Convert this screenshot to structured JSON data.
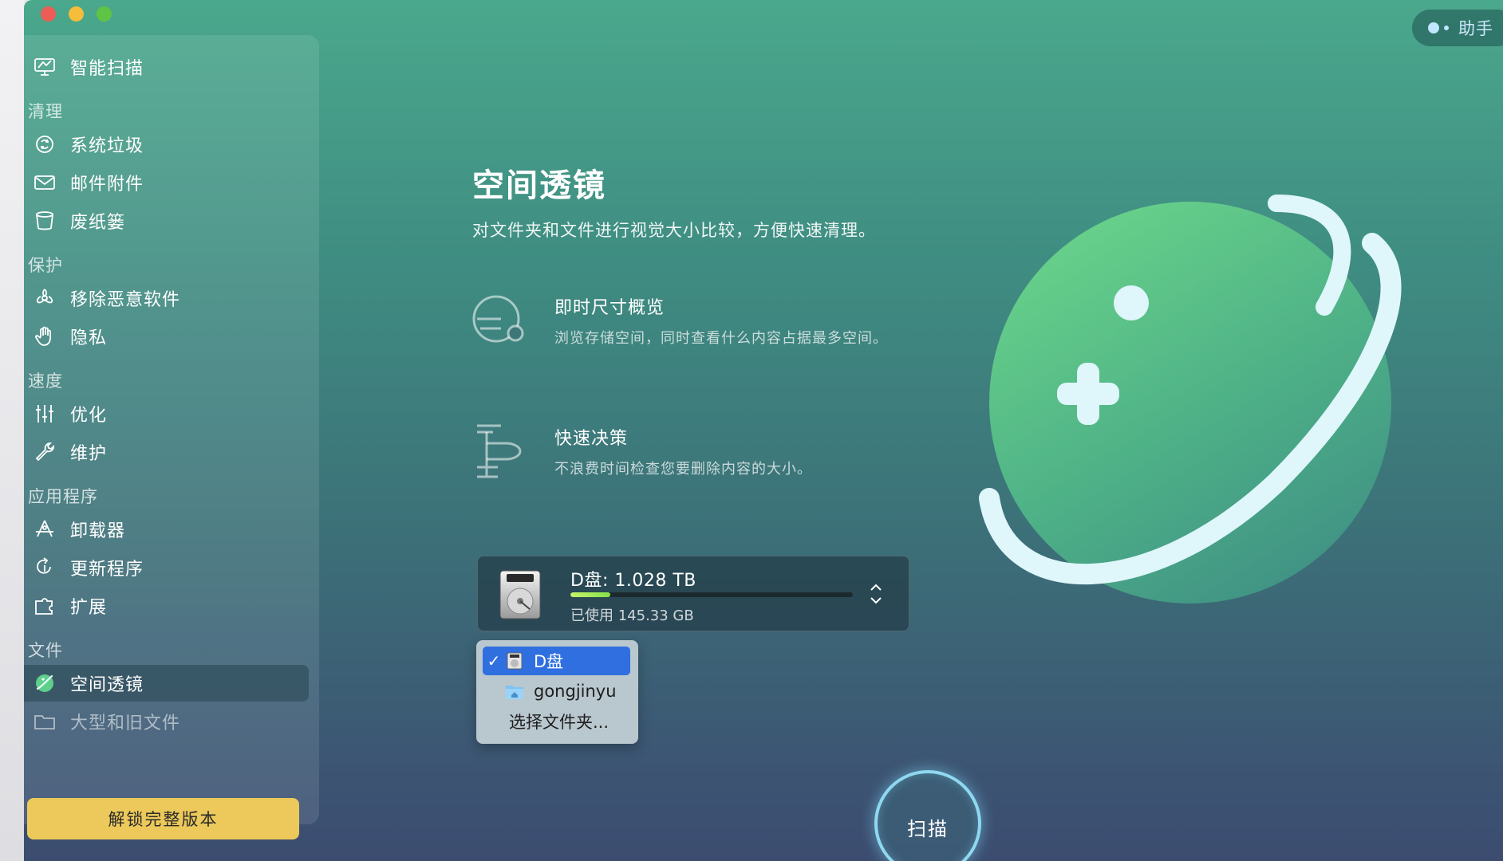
{
  "app": {
    "assistant_label": "助手",
    "colors": {
      "accent_unlock": "#ecc95a",
      "selection": "#2f6fe0",
      "progress": "#a6e85a"
    }
  },
  "sidebar": {
    "items": [
      {
        "label": "智能扫描",
        "icon": "monitor-scan-icon"
      },
      {
        "label": "清理",
        "type": "header"
      },
      {
        "label": "系统垃圾",
        "icon": "recycle-icon"
      },
      {
        "label": "邮件附件",
        "icon": "mail-icon"
      },
      {
        "label": "废纸篓",
        "icon": "trash-icon"
      },
      {
        "label": "保护",
        "type": "header"
      },
      {
        "label": "移除恶意软件",
        "icon": "biohazard-icon"
      },
      {
        "label": "隐私",
        "icon": "hand-icon"
      },
      {
        "label": "速度",
        "type": "header"
      },
      {
        "label": "优化",
        "icon": "sliders-icon"
      },
      {
        "label": "维护",
        "icon": "wrench-icon"
      },
      {
        "label": "应用程序",
        "type": "header"
      },
      {
        "label": "卸载器",
        "icon": "apps-icon"
      },
      {
        "label": "更新程序",
        "icon": "update-icon"
      },
      {
        "label": "扩展",
        "icon": "extension-icon"
      },
      {
        "label": "文件",
        "type": "header"
      },
      {
        "label": "空间透镜",
        "icon": "space-lens-icon",
        "active": true
      },
      {
        "label": "大型和旧文件",
        "icon": "folder-icon"
      }
    ],
    "unlock_label": "解锁完整版本"
  },
  "main": {
    "title": "空间透镜",
    "subtitle": "对文件夹和文件进行视觉大小比较，方便快速清理。",
    "features": [
      {
        "title": "即时尺寸概览",
        "desc": "浏览存储空间，同时查看什么内容占据最多空间。",
        "icon": "size-overview-icon"
      },
      {
        "title": "快速决策",
        "desc": "不浪费时间检查您要删除内容的大小。",
        "icon": "quick-decision-icon"
      }
    ],
    "disk": {
      "name": "D盘: 1.028 TB",
      "used": "已使用 145.33 GB",
      "used_fraction": 0.141
    },
    "dropdown": {
      "items": [
        {
          "label": "D盘",
          "selected": true,
          "icon": "drive-icon"
        },
        {
          "label": "gongjinyu",
          "selected": false,
          "icon": "home-folder-icon"
        },
        {
          "label": "选择文件夹...",
          "selected": false
        }
      ],
      "check": "✓"
    },
    "scan_label": "扫描"
  }
}
